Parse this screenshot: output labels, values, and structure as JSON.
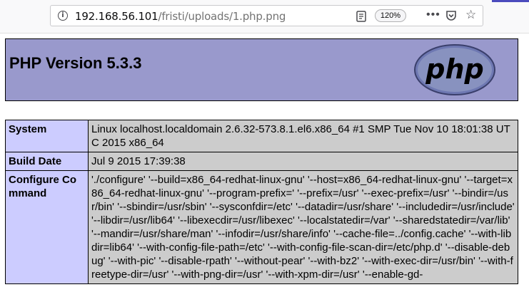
{
  "browser": {
    "url_host": "192.168.56.101",
    "url_path": "/fristi/uploads/1.php.png",
    "zoom": "120%",
    "info_icon": "info-icon",
    "reader_icon": "reader-view-icon",
    "menu_icon": "more-actions-icon",
    "pocket_icon": "pocket-icon",
    "bookmark_icon": "bookmark-star-icon",
    "accent_color": "#4b4bbd"
  },
  "page": {
    "title": "PHP Version 5.3.3",
    "logo_text": "php",
    "header_color": "#9999cc",
    "label_color": "#ccccff",
    "value_color": "#cccccc",
    "rows": [
      {
        "label": "System",
        "value": "Linux localhost.localdomain 2.6.32-573.8.1.el6.x86_64 #1 SMP Tue Nov 10 18:01:38 UTC 2015 x86_64"
      },
      {
        "label": "Build Date",
        "value": "Jul 9 2015 17:39:38"
      },
      {
        "label": "Configure Command",
        "value": "'./configure' '--build=x86_64-redhat-linux-gnu' '--host=x86_64-redhat-linux-gnu' '--target=x86_64-redhat-linux-gnu' '--program-prefix=' '--prefix=/usr' '--exec-prefix=/usr' '--bindir=/usr/bin' '--sbindir=/usr/sbin' '--sysconfdir=/etc' '--datadir=/usr/share' '--includedir=/usr/include' '--libdir=/usr/lib64' '--libexecdir=/usr/libexec' '--localstatedir=/var' '--sharedstatedir=/var/lib' '--mandir=/usr/share/man' '--infodir=/usr/share/info' '--cache-file=../config.cache' '--with-libdir=lib64' '--with-config-file-path=/etc' '--with-config-file-scan-dir=/etc/php.d' '--disable-debug' '--with-pic' '--disable-rpath' '--without-pear' '--with-bz2' '--with-exec-dir=/usr/bin' '--with-freetype-dir=/usr' '--with-png-dir=/usr' '--with-xpm-dir=/usr' '--enable-gd-"
      }
    ]
  }
}
